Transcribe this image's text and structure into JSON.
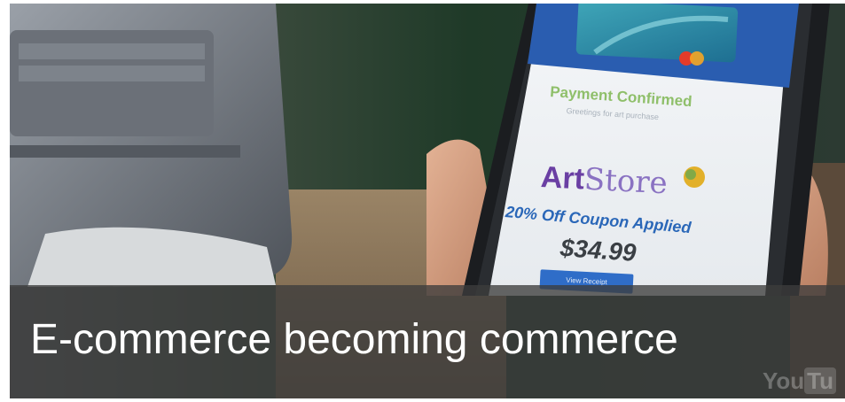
{
  "phone_screen": {
    "status": "Payment Confirmed",
    "status_sub": "Greetings for art purchase",
    "brand_part1": "Art",
    "brand_part2": "Store",
    "coupon": "20% Off Coupon Applied",
    "price": "$34.99",
    "button_label": "View Receipt"
  },
  "caption": {
    "text": "E-commerce becoming commerce"
  },
  "watermark": {
    "part1": "You",
    "part2": "Tu"
  },
  "colors": {
    "overlay": "#3c3c3c",
    "caption": "#ffffff",
    "phone_header": "#2a5db0",
    "brand_purple": "#6a3fa3",
    "coupon_blue": "#2a67b8"
  }
}
